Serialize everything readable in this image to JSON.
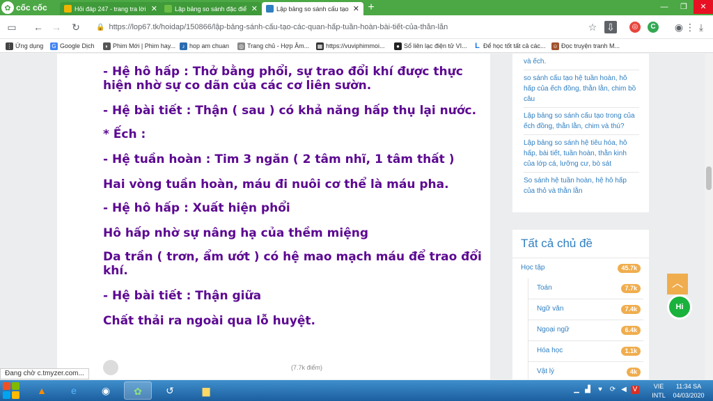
{
  "browser": {
    "brand": "cốc cốc",
    "tabs": [
      {
        "title": "Hỏi đáp 247 - trang tra lời",
        "color": "#f0b400"
      },
      {
        "title": "Lập bảng so sánh đặc điể",
        "color": "#6cbd45"
      },
      {
        "title": "Lập bảng so sánh cấu tạo",
        "color": "#2f7fc1"
      }
    ],
    "url": "https://lop67.tk/hoidap/150866/lập-bảng-sánh-cấu-tạo-các-quan-hấp-tuần-hoàn-bài-tiết-của-thằn-lằn",
    "bookmarks": [
      {
        "label": "Ứng dụng",
        "icon": "apps-icon",
        "color": "#444444"
      },
      {
        "label": "Google Dịch",
        "icon": "translate-icon",
        "color": "#4285f4"
      },
      {
        "label": "Phim Mới | Phim hay...",
        "icon": "film-icon",
        "color": "#555555"
      },
      {
        "label": "hop am chuan",
        "icon": "music-icon",
        "color": "#2b6cb0"
      },
      {
        "label": "Trang chủ - Hợp Âm...",
        "icon": "chord-icon",
        "color": "#888888"
      },
      {
        "label": "https://vuviphimmoi...",
        "icon": "movie-icon",
        "color": "#333333"
      },
      {
        "label": "Sổ liên lạc điện tử VI...",
        "icon": "book-icon",
        "color": "#222222"
      },
      {
        "label": "Để học tốt tất cả các...",
        "icon": "letter-l-icon",
        "color": "#1a73e8"
      },
      {
        "label": "Đọc truyện tranh M...",
        "icon": "manga-icon",
        "color": "#a0522d"
      }
    ]
  },
  "article": {
    "lines": [
      "- Hệ hô hấp : Thở bằng phổi, sự trao đổi khí được thực hiện nhờ sự co dãn của các cơ liên sườn.",
      "- Hệ bài tiết : Thận ( sau ) có khả năng hấp thụ lại nước.",
      "* Ếch :",
      "- Hệ tuần hoàn : Tim 3 ngăn ( 2 tâm nhĩ, 1 tâm thất )",
      "Hai vòng tuần hoàn, máu đi nuôi cơ thể là máu pha.",
      "- Hệ hô hấp : Xuất hiện phổi",
      "Hô hấp nhờ sự nâng hạ của thềm miệng",
      "Da trần ( trơn, ẩm ướt ) có hệ mao mạch máu để trao đổi khí.",
      "- Hệ bài tiết : Thận giữa",
      "Chất thải ra ngoài qua lỗ huyệt."
    ],
    "author_points": "(7.7k điểm)"
  },
  "sidebar": {
    "related": [
      "và ếch.",
      "so sánh cấu tạo hệ tuần hoàn, hô hấp của ếch đồng, thằn lằn, chim bồ câu",
      "Lập bảng so sánh cấu tạo trong của ếch đồng, thằn lằn, chim và thú?",
      "Lập bảng so sánh hệ tiêu hóa, hô hấp, bài tiết, tuần hoàn, thằn kinh của lớp cá, lưỡng cư, bò sát",
      "So sánh hệ tuần hoàn, hệ hô hấp của thỏ và thằn lằn"
    ],
    "topics_title": "Tất cả chủ đề",
    "topic_head": {
      "name": "Học tập",
      "count": "45.7k"
    },
    "topics": [
      {
        "name": "Toán",
        "count": "7.7k"
      },
      {
        "name": "Ngữ văn",
        "count": "7.4k"
      },
      {
        "name": "Ngoại ngữ",
        "count": "6.4k"
      },
      {
        "name": "Hóa học",
        "count": "1.1k"
      },
      {
        "name": "Vật lý",
        "count": "4k"
      }
    ]
  },
  "status_text": "Đang chờ c.tmyzer.com...",
  "taskbar": {
    "lang": "VIE",
    "layout": "INTL",
    "time": "11:34 SA",
    "date": "04/03/2020"
  },
  "colors": {
    "browser_green": "#4ca745",
    "article_text": "#5c0891",
    "link_blue": "#2f7fc1",
    "badge_orange": "#f0ad4e"
  }
}
